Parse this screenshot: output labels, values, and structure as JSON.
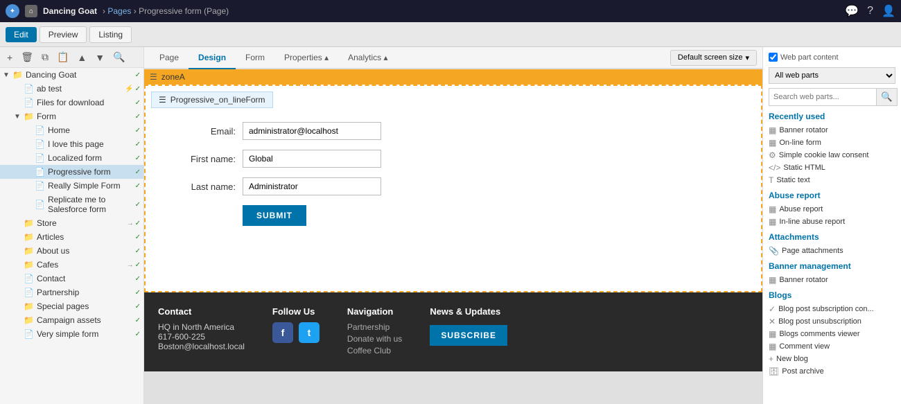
{
  "topbar": {
    "site_name": "Dancing Goat",
    "breadcrumb_pages": "Pages",
    "breadcrumb_current": "Progressive form",
    "breadcrumb_type": "(Page)"
  },
  "edit_toolbar": {
    "edit_label": "Edit",
    "preview_label": "Preview",
    "listing_label": "Listing"
  },
  "tabs": {
    "page": "Page",
    "design": "Design",
    "form": "Form",
    "properties": "Properties",
    "analytics": "Analytics",
    "screen_size": "Default screen size"
  },
  "sidebar": {
    "items": [
      {
        "label": "Dancing Goat",
        "level": 0,
        "type": "folder",
        "expanded": true,
        "status": "green"
      },
      {
        "label": "ab test",
        "level": 1,
        "type": "page",
        "status": "green",
        "extra": "⚡"
      },
      {
        "label": "Files for download",
        "level": 1,
        "type": "page",
        "status": "green"
      },
      {
        "label": "Form",
        "level": 1,
        "type": "folder",
        "expanded": true,
        "status": "green"
      },
      {
        "label": "Home",
        "level": 2,
        "type": "page",
        "status": "green"
      },
      {
        "label": "I love this page",
        "level": 2,
        "type": "page",
        "status": "green"
      },
      {
        "label": "Localized form",
        "level": 2,
        "type": "page",
        "status": "green"
      },
      {
        "label": "Progressive form",
        "level": 2,
        "type": "page",
        "status": "green",
        "selected": true
      },
      {
        "label": "Really Simple Form",
        "level": 2,
        "type": "page",
        "status": "green"
      },
      {
        "label": "Replicate me to Salesforce form",
        "level": 2,
        "type": "page",
        "status": "green"
      },
      {
        "label": "Store",
        "level": 1,
        "type": "folder",
        "status": "green",
        "arrow": true
      },
      {
        "label": "Articles",
        "level": 1,
        "type": "folder",
        "status": "green"
      },
      {
        "label": "About us",
        "level": 1,
        "type": "folder",
        "status": "green"
      },
      {
        "label": "Cafes",
        "level": 1,
        "type": "folder",
        "status": "green",
        "arrow": true
      },
      {
        "label": "Contact",
        "level": 1,
        "type": "page",
        "status": "green"
      },
      {
        "label": "Partnership",
        "level": 1,
        "type": "page",
        "status": "green"
      },
      {
        "label": "Special pages",
        "level": 1,
        "type": "folder",
        "status": "green"
      },
      {
        "label": "Campaign assets",
        "level": 1,
        "type": "folder",
        "status": "green"
      },
      {
        "label": "Very simple form",
        "level": 1,
        "type": "page",
        "status": "green"
      }
    ]
  },
  "zone": {
    "name": "zoneA"
  },
  "widget": {
    "name": "Progressive_on_lineForm"
  },
  "form": {
    "email_label": "Email:",
    "email_value": "administrator@localhost",
    "firstname_label": "First name:",
    "firstname_value": "Global",
    "lastname_label": "Last name:",
    "lastname_value": "Administrator",
    "submit_label": "SUBMIT"
  },
  "footer": {
    "contact_title": "Contact",
    "contact_hq": "HQ in North America",
    "contact_phone": "617-600-225",
    "contact_email": "Boston@localhost.local",
    "follow_title": "Follow Us",
    "navigation_title": "Navigation",
    "nav_partnership": "Partnership",
    "nav_donate": "Donate with us",
    "nav_coffee": "Coffee Club",
    "news_title": "News & Updates",
    "subscribe_label": "SUBSCRIBE"
  },
  "right_panel": {
    "webparts_checkbox_label": "Web part content",
    "dropdown_option": "All web parts",
    "search_placeholder": "Search web parts...",
    "recently_used_title": "Recently used",
    "recently_used_items": [
      {
        "label": "Banner rotator",
        "icon": "layout"
      },
      {
        "label": "On-line form",
        "icon": "layout"
      },
      {
        "label": "Simple cookie law consent",
        "icon": "gear"
      },
      {
        "label": "Static HTML",
        "icon": "code"
      },
      {
        "label": "Static text",
        "icon": "text"
      }
    ],
    "abuse_report_title": "Abuse report",
    "abuse_report_items": [
      {
        "label": "Abuse report",
        "icon": "layout"
      },
      {
        "label": "In-line abuse report",
        "icon": "layout"
      }
    ],
    "attachments_title": "Attachments",
    "attachments_items": [
      {
        "label": "Page attachments",
        "icon": "paperclip"
      }
    ],
    "banner_management_title": "Banner management",
    "banner_management_items": [
      {
        "label": "Banner rotator",
        "icon": "layout"
      }
    ],
    "blogs_title": "Blogs",
    "blogs_items": [
      {
        "label": "Blog post subscription con...",
        "icon": "check"
      },
      {
        "label": "Blog post unsubscription",
        "icon": "x"
      },
      {
        "label": "Blogs comments viewer",
        "icon": "layout"
      },
      {
        "label": "Comment view",
        "icon": "layout"
      },
      {
        "label": "New blog",
        "icon": "plus"
      },
      {
        "label": "Post archive",
        "icon": "archive"
      }
    ]
  }
}
